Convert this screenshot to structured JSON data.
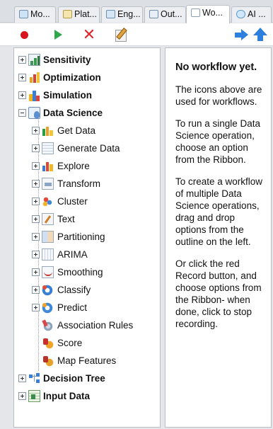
{
  "tabs": [
    {
      "label": "Mo..."
    },
    {
      "label": "Plat..."
    },
    {
      "label": "Eng..."
    },
    {
      "label": "Out..."
    },
    {
      "label": "Wo..."
    },
    {
      "label": "AI ..."
    }
  ],
  "toolbar": {
    "record": "record-icon",
    "run": "play-icon",
    "delete": "delete-icon",
    "edit": "edit-icon",
    "forward": "arrow-right-icon",
    "up": "arrow-up-icon"
  },
  "tree": {
    "top": [
      {
        "label": "Sensitivity"
      },
      {
        "label": "Optimization"
      },
      {
        "label": "Simulation"
      },
      {
        "label": "Data Science"
      }
    ],
    "data_science_children": [
      {
        "label": "Get Data"
      },
      {
        "label": "Generate Data"
      },
      {
        "label": "Explore"
      },
      {
        "label": "Transform"
      },
      {
        "label": "Cluster"
      },
      {
        "label": "Text"
      },
      {
        "label": "Partitioning"
      },
      {
        "label": "ARIMA"
      },
      {
        "label": "Smoothing"
      },
      {
        "label": "Classify"
      },
      {
        "label": "Predict"
      },
      {
        "label": "Association Rules"
      },
      {
        "label": "Score"
      },
      {
        "label": "Map Features"
      }
    ],
    "bottom": [
      {
        "label": "Decision Tree"
      },
      {
        "label": "Input Data"
      }
    ]
  },
  "info": {
    "heading": "No workflow yet.",
    "p1": "The icons above are used for workflows.",
    "p2": "To run a single Data Science operation, choose an option from the Ribbon.",
    "p3": "To create a workflow of multiple Data Science operations, drag and drop options from the outline on the left.",
    "p4": "Or click the red Record button, and choose options from the Ribbon- when done, click to stop recording."
  },
  "colors": {
    "record": "#d6151d",
    "run": "#2ea84a",
    "delete": "#e0262d",
    "nav_arrows": "#2d7fe0"
  }
}
